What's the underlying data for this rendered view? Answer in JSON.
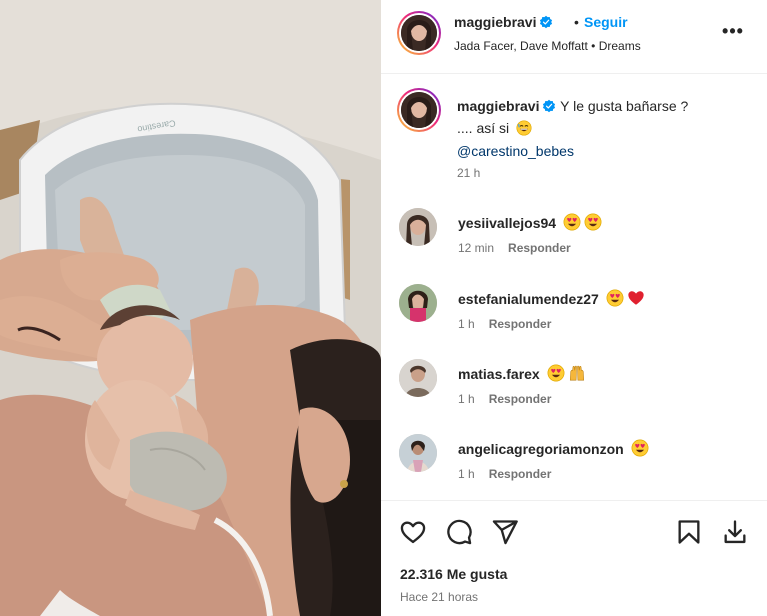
{
  "post": {
    "username": "maggiebravi",
    "separator": "•",
    "follow_label": "Seguir",
    "audio": "Jada Facer, Dave Moffatt • Dreams",
    "more_label": "•••"
  },
  "caption": {
    "username": "maggiebravi",
    "line1": "Y le gusta bañarse ?",
    "line2": ".... así si",
    "mention": "@carestino_bebes",
    "time": "21 h"
  },
  "photo": {
    "tub_brand": "Carestino"
  },
  "comments": [
    {
      "username": "yesiivallejos94",
      "emojis": [
        "heart-eyes",
        "heart-eyes"
      ],
      "time": "12 min",
      "reply": "Responder"
    },
    {
      "username": "estefanialumendez27",
      "emojis": [
        "heart-eyes",
        "red-heart"
      ],
      "time": "1 h",
      "reply": "Responder"
    },
    {
      "username": "matias.farex",
      "emojis": [
        "heart-eyes",
        "raising-hands"
      ],
      "time": "1 h",
      "reply": "Responder"
    },
    {
      "username": "angelicagregoriamonzon",
      "emojis": [
        "heart-eyes"
      ],
      "time": "1 h",
      "reply": "Responder"
    }
  ],
  "stats": {
    "likes": "22.316 Me gusta",
    "posted": "Hace 21 horas"
  },
  "colors": {
    "follow": "#0095f6",
    "mention": "#00376b",
    "verified": "#0095f6",
    "secondary_text": "#737373"
  }
}
